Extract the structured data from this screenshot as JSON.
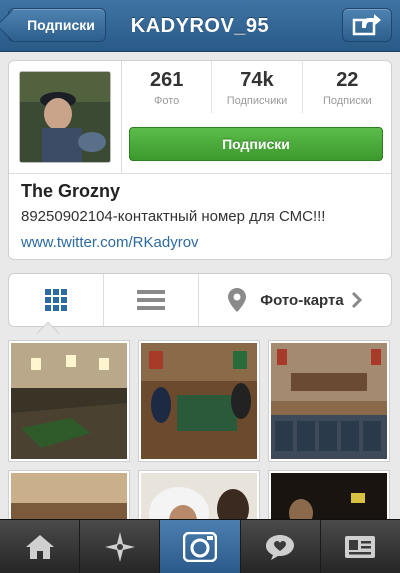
{
  "navbar": {
    "back_label": "Подписки",
    "title": "KADYROV_95",
    "share_icon": "share-icon"
  },
  "profile": {
    "avatar_icon": "profile-photo",
    "stats": [
      {
        "value": "261",
        "label": "Фото"
      },
      {
        "value": "74k",
        "label": "Подписчики"
      },
      {
        "value": "22",
        "label": "Подписки"
      }
    ],
    "follow_label": "Подписки",
    "name": "The Grozny",
    "bio": "89250902104-контактный номер для СМС!!!",
    "link": "www.twitter.com/RKadyrov"
  },
  "view_toggle": {
    "grid_icon": "grid-icon",
    "list_icon": "list-icon",
    "map_icon": "location-pin-icon",
    "map_label": "Фото-карта",
    "chevron_icon": "chevron-right-icon"
  },
  "tabbar": {
    "items": [
      {
        "icon": "home-icon",
        "active": false
      },
      {
        "icon": "explore-icon",
        "active": false
      },
      {
        "icon": "camera-icon",
        "active": true
      },
      {
        "icon": "news-icon",
        "active": false
      },
      {
        "icon": "profile-card-icon",
        "active": false
      }
    ]
  },
  "colors": {
    "nav_blue": "#295a88",
    "follow_green": "#3c9a2c",
    "link_blue": "#2d6a9f",
    "active_tab": "#2a5a8a"
  }
}
